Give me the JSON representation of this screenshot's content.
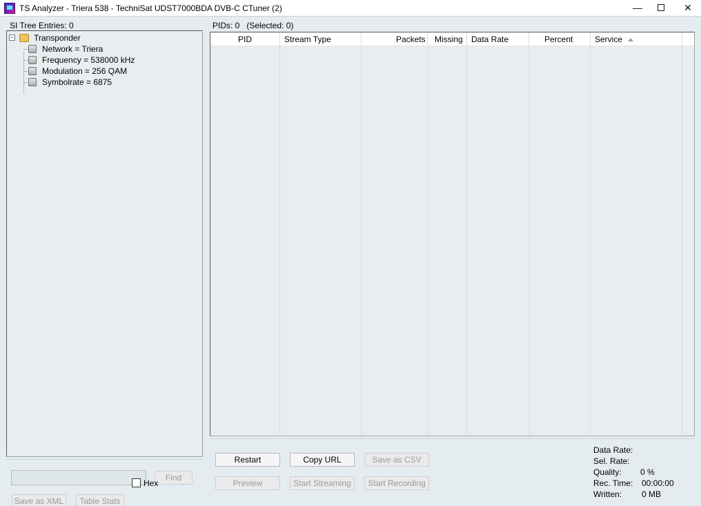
{
  "window": {
    "title": "TS Analyzer - Triera 538 - TechniSat UDST7000BDA DVB-C CTuner (2)",
    "minimize": "—",
    "close": "✕"
  },
  "si_tree": {
    "header": "SI Tree Entries: 0",
    "root": {
      "label": "Transponder",
      "expander": "−"
    },
    "children": [
      {
        "label": "Network = Triera"
      },
      {
        "label": "Frequency = 538000 kHz"
      },
      {
        "label": "Modulation = 256 QAM"
      },
      {
        "label": "Symbolrate = 6875"
      }
    ]
  },
  "left_controls": {
    "find_placeholder": "",
    "find_label": "Find",
    "save_xml_label": "Save as XML",
    "table_stats_label": "Table Stats",
    "hex_label": "Hex",
    "hex_checked": false
  },
  "pids": {
    "header": "PIDs: 0   (Selected: 0)",
    "columns": [
      "PID",
      "Stream Type",
      "Packets",
      "Missing",
      "Data Rate",
      "Percent",
      "Service"
    ],
    "rows": []
  },
  "right_controls": {
    "restart_label": "Restart",
    "copy_url_label": "Copy URL",
    "save_csv_label": "Save as CSV",
    "preview_label": "Preview",
    "start_streaming_label": "Start Streaming",
    "start_recording_label": "Start Recording"
  },
  "stats": {
    "data_rate_label": "Data Rate:",
    "data_rate_value": "",
    "sel_rate_label": "Sel. Rate:",
    "sel_rate_value": "",
    "quality_label": "Quality:",
    "quality_value": "0 %",
    "rec_time_label": "Rec. Time:",
    "rec_time_value": "00:00:00",
    "written_label": "Written:",
    "written_value": "0 MB"
  }
}
